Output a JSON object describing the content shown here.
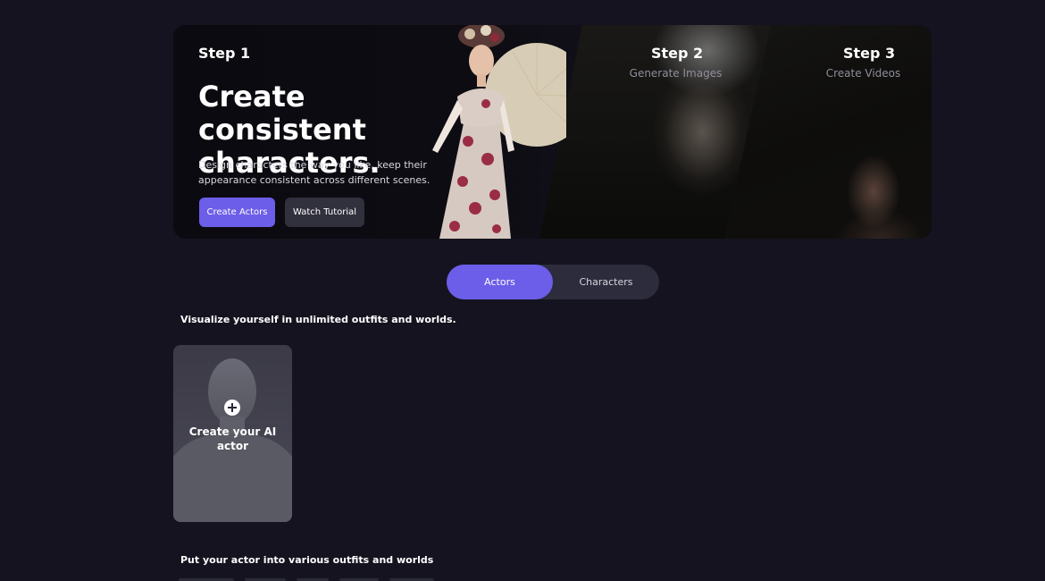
{
  "hero": {
    "step1": {
      "label": "Step 1",
      "title": "Create consistent characters.",
      "description": "Design characters the way you like, keep their appearance consistent across different scenes.",
      "primary_button": "Create Actors",
      "secondary_button": "Watch Tutorial"
    },
    "step2": {
      "label": "Step 2",
      "subtitle": "Generate Images"
    },
    "step3": {
      "label": "Step 3",
      "subtitle": "Create Videos"
    }
  },
  "tabs": {
    "actors": "Actors",
    "characters": "Characters",
    "active": "Actors"
  },
  "actors_section": {
    "heading": "Visualize yourself in unlimited outfits and worlds.",
    "create_card_label": "Create your AI actor"
  },
  "outfits_section": {
    "heading": "Put your actor into various outfits and worlds"
  },
  "colors": {
    "background": "#14131f",
    "accent": "#6c5ee8",
    "secondary_button": "#31303d",
    "tab_track": "#2c2c3d"
  }
}
